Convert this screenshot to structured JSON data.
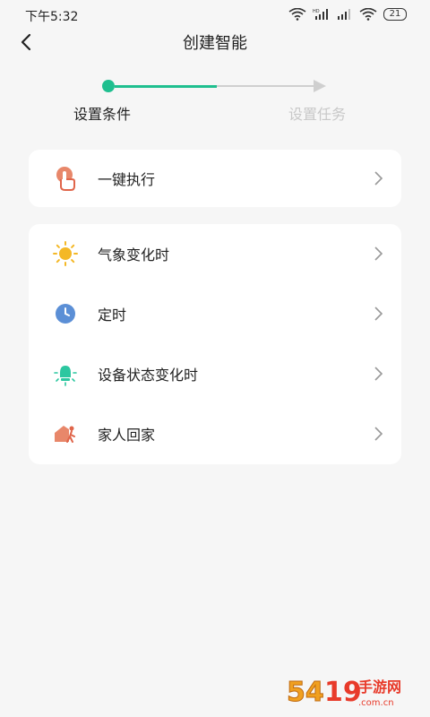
{
  "status_bar": {
    "time": "下午5:32",
    "battery": "21"
  },
  "nav": {
    "title": "创建智能"
  },
  "stepper": {
    "step1_label": "设置条件",
    "step2_label": "设置任务",
    "active_color": "#1fbf8f",
    "inactive_color": "#cfcfcf"
  },
  "quick_actions": [
    {
      "label": "一键执行",
      "icon": "tap-hand-icon"
    }
  ],
  "conditions": [
    {
      "label": "气象变化时",
      "icon": "sun-icon"
    },
    {
      "label": "定时",
      "icon": "clock-icon"
    },
    {
      "label": "设备状态变化时",
      "icon": "device-bulb-icon"
    },
    {
      "label": "家人回家",
      "icon": "home-person-icon"
    }
  ],
  "watermark": {
    "text": "5419手游网",
    "subtext": "www.5419.com.cn"
  }
}
